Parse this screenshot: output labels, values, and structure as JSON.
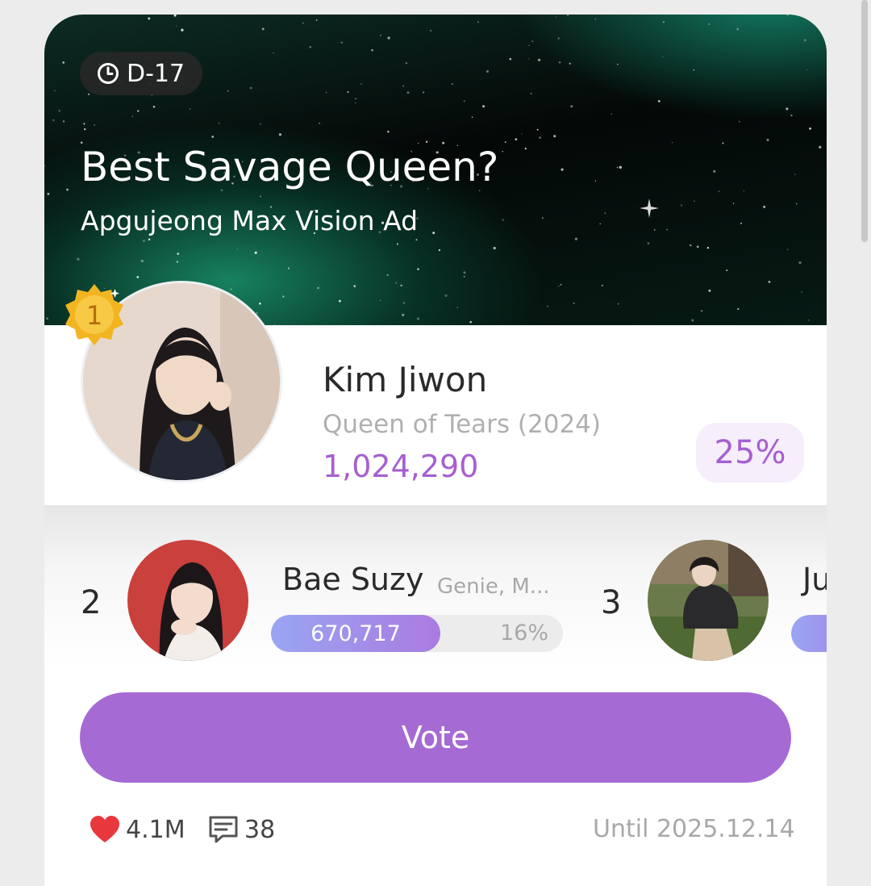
{
  "poll": {
    "dday": "D-17",
    "title": "Best Savage Queen?",
    "subtitle": "Apgujeong Max Vision Ad"
  },
  "first_place": {
    "rank": "1",
    "name": "Kim Jiwon",
    "work": "Queen of Tears (2024)",
    "votes": "1,024,290",
    "percent": "25%"
  },
  "runners": [
    {
      "rank": "2",
      "name": "Bae Suzy",
      "meta": "Genie, M...",
      "votes": "670,717",
      "percent": "16%",
      "fill_fraction": 0.58
    },
    {
      "rank": "3",
      "name": "Ju",
      "fill_fraction": 0.3
    }
  ],
  "actions": {
    "vote_label": "Vote"
  },
  "footer": {
    "likes": "4.1M",
    "comments": "38",
    "until": "Until 2025.12.14"
  },
  "colors": {
    "accent": "#a66ad4",
    "heart": "#e8383d"
  },
  "icons": {
    "dday": "clock-icon",
    "likes": "heart-icon",
    "comments": "comment-icon",
    "rank_badge": "gold-medal-icon"
  }
}
